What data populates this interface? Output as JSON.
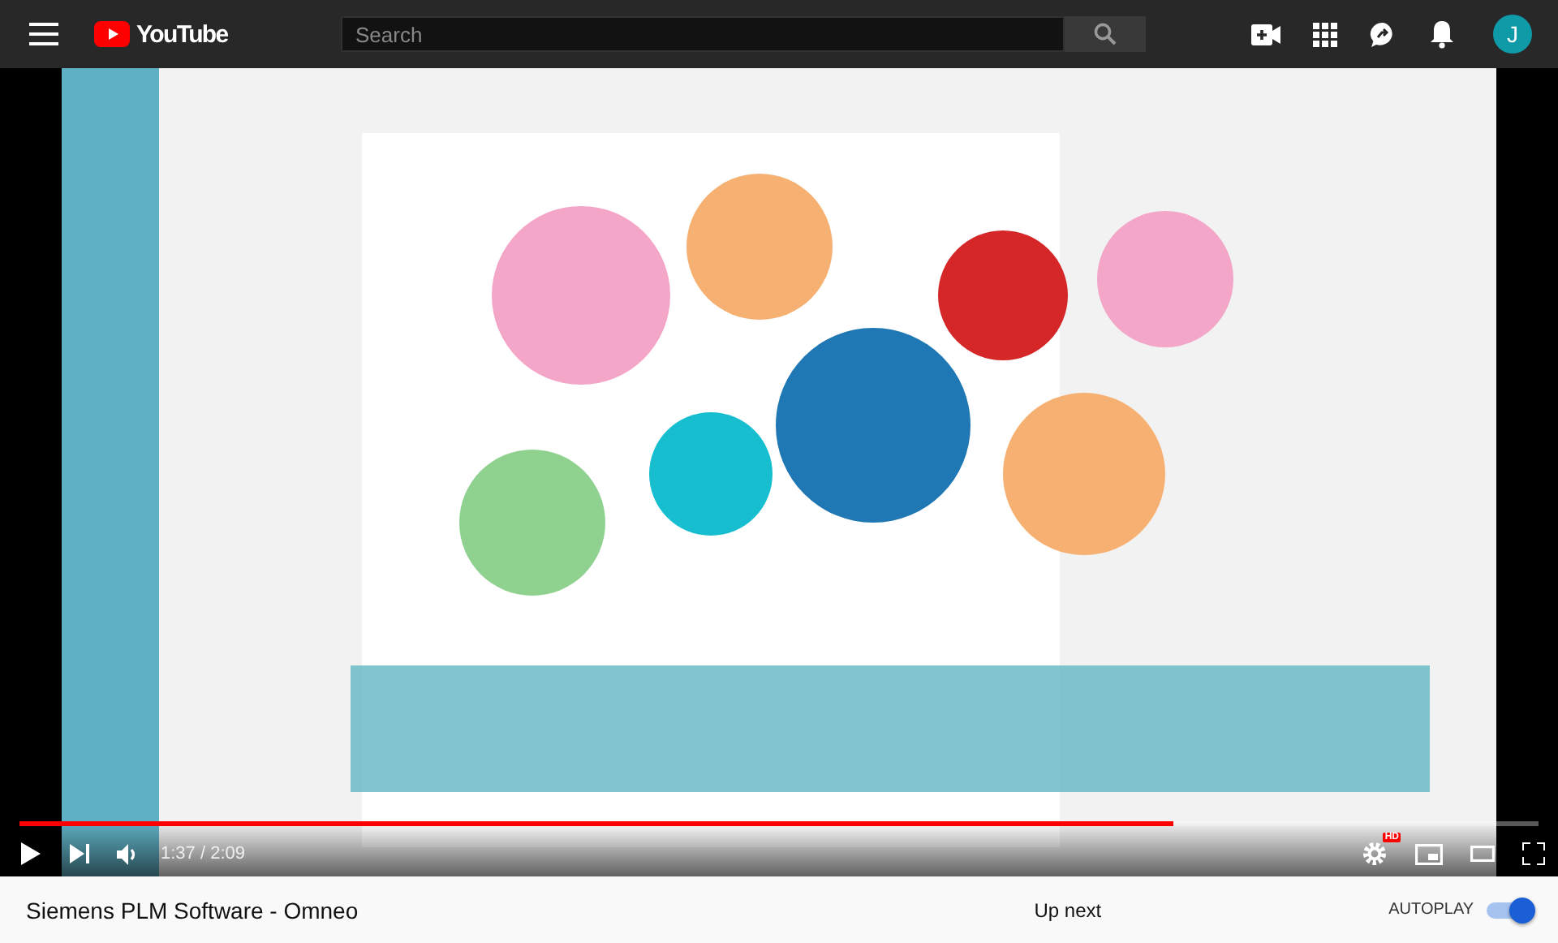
{
  "header": {
    "logo": "YouTube",
    "search": {
      "placeholder": "Search"
    },
    "avatar": "J"
  },
  "player": {
    "progress": {
      "level": 0.76
    },
    "time": "1:37 / 2:09",
    "hd_badge": "HD"
  },
  "below": {
    "title": "Siemens PLM Software - Omneo",
    "up_next": "Up next",
    "autoplay": {
      "label": "AUTOPLAY",
      "on": true
    }
  }
}
